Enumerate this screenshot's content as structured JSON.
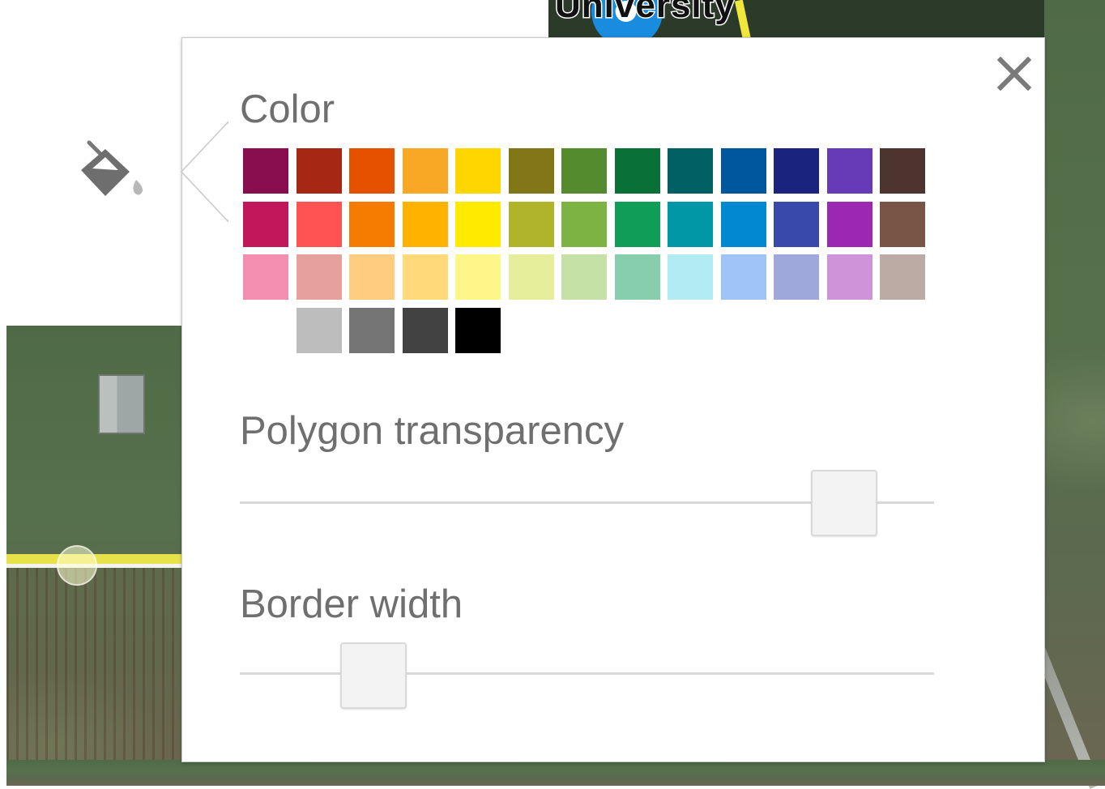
{
  "map": {
    "label": "University"
  },
  "tool": {
    "icon": "paint-bucket-icon"
  },
  "popup": {
    "close_icon": "close-icon",
    "color_section": {
      "title": "Color",
      "swatch_rows": [
        [
          "#880e4f",
          "#a52714",
          "#e65100",
          "#f9a825",
          "#ffd600",
          "#817717",
          "#558b2f",
          "#097138",
          "#006064",
          "#01579b",
          "#1a237e",
          "#673ab7",
          "#4e342e"
        ],
        [
          "#c2185b",
          "#ff5252",
          "#f57c00",
          "#ffb300",
          "#ffea00",
          "#afb42b",
          "#7cb342",
          "#0f9d58",
          "#0097a7",
          "#0288d1",
          "#3949ab",
          "#9c27b0",
          "#795548"
        ],
        [
          "#f48fb1",
          "#e6a19c",
          "#ffcc80",
          "#ffd97a",
          "#fff68a",
          "#e6ee9c",
          "#c5e1a5",
          "#87ceac",
          "#b2ebf2",
          "#9fc5f8",
          "#9fa8da",
          "#ce93d8",
          "#bcaaa4"
        ],
        [
          "#bdbdbd",
          "#757575",
          "#424242",
          "#000000"
        ]
      ]
    },
    "transparency": {
      "title": "Polygon transparency",
      "value": 0.91
    },
    "border_width": {
      "title": "Border width",
      "value": 0.16
    }
  }
}
